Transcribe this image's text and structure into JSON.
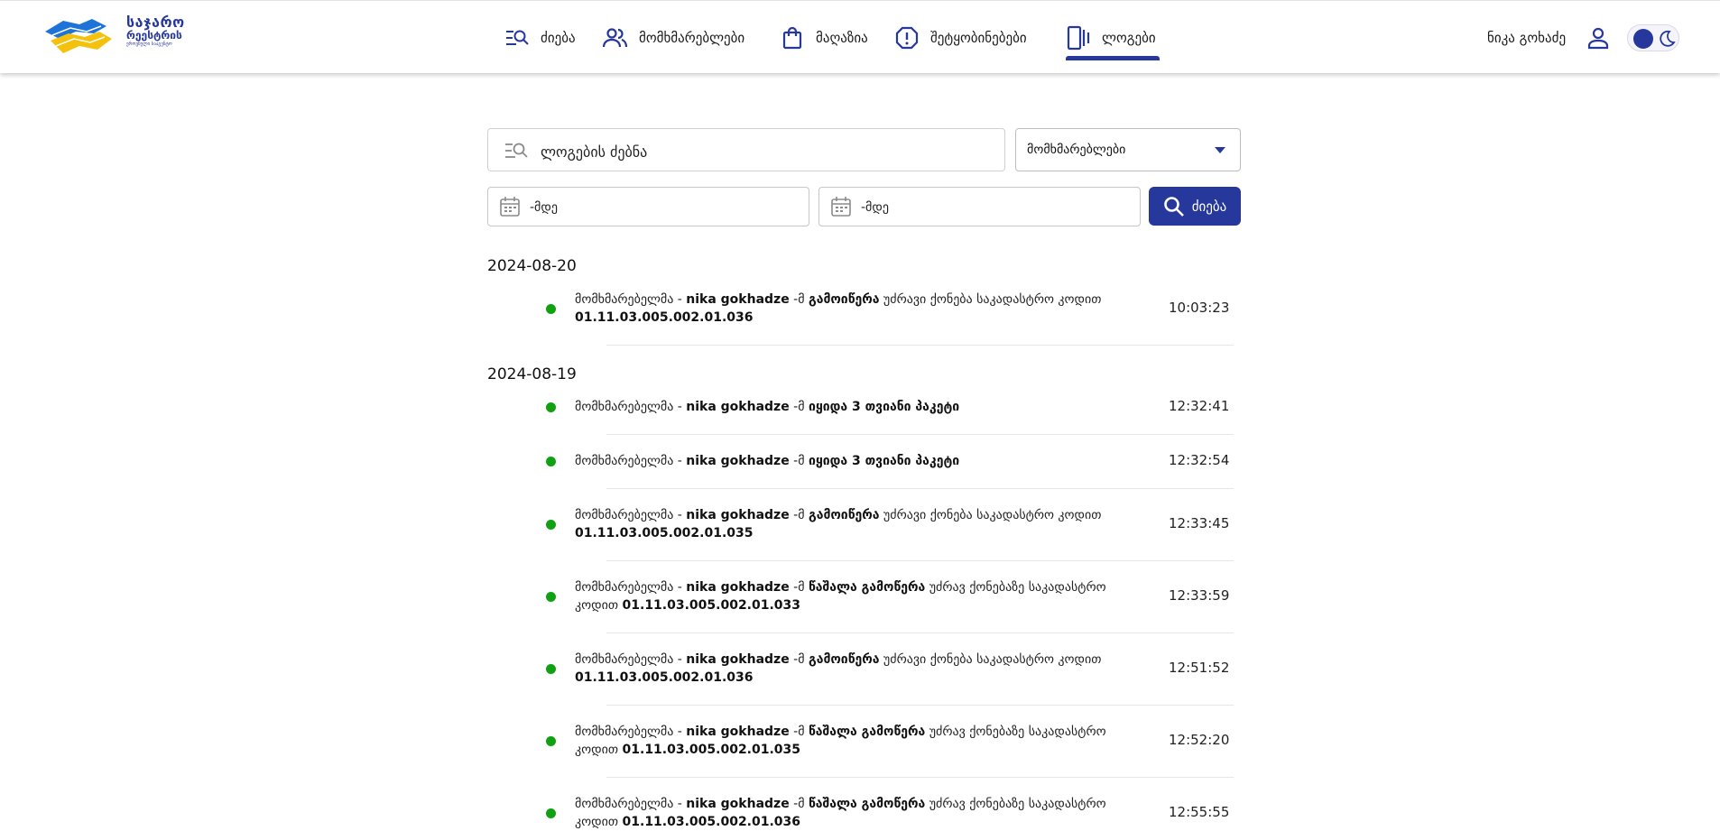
{
  "header": {
    "logo": {
      "line1": "საჯარო",
      "line2": "რეესტრის",
      "line3": "ეროვნული სააგენტო"
    },
    "nav": [
      {
        "label": "ძიება",
        "icon": "search-list-icon"
      },
      {
        "label": "მომხმარებლები",
        "icon": "users-icon"
      },
      {
        "label": "მაღაზია",
        "icon": "shopping-bag-icon"
      },
      {
        "label": "შეტყობინებები",
        "icon": "alert-icon"
      },
      {
        "label": "ლოგები",
        "icon": "logs-icon",
        "active": true
      }
    ],
    "user_name": "ნიკა გოხაძე",
    "accent_color": "#26389c"
  },
  "filters": {
    "search_placeholder": "ლოგების ძებნა",
    "search_value": "",
    "select_value": "მომხმარებლები",
    "date_from_placeholder": "-მდე",
    "date_to_placeholder": "-მდე",
    "search_button": "ძიება"
  },
  "logs": [
    {
      "date": "2024-08-20",
      "entries": [
        {
          "parts": [
            {
              "t": "მომხმარებელმა - "
            },
            {
              "t": "nika gokhadze",
              "b": true
            },
            {
              "t": " -მ "
            },
            {
              "t": "გამოიწერა",
              "b": true
            },
            {
              "t": " უძრავი ქონება საკადასტრო კოდით "
            },
            {
              "t": "01.11.03.005.002.01.036",
              "b": true
            }
          ],
          "time": "10:03:23"
        }
      ]
    },
    {
      "date": "2024-08-19",
      "entries": [
        {
          "parts": [
            {
              "t": "მომხმარებელმა - "
            },
            {
              "t": "nika gokhadze",
              "b": true
            },
            {
              "t": " -მ "
            },
            {
              "t": "იყიდა 3 თვიანი პაკეტი",
              "b": true
            }
          ],
          "time": "12:32:41"
        },
        {
          "parts": [
            {
              "t": "მომხმარებელმა - "
            },
            {
              "t": "nika gokhadze",
              "b": true
            },
            {
              "t": " -მ "
            },
            {
              "t": "იყიდა 3 თვიანი პაკეტი",
              "b": true
            }
          ],
          "time": "12:32:54"
        },
        {
          "parts": [
            {
              "t": "მომხმარებელმა - "
            },
            {
              "t": "nika gokhadze",
              "b": true
            },
            {
              "t": " -მ "
            },
            {
              "t": "გამოიწერა",
              "b": true
            },
            {
              "t": " უძრავი ქონება საკადასტრო კოდით "
            },
            {
              "t": "01.11.03.005.002.01.035",
              "b": true
            }
          ],
          "time": "12:33:45"
        },
        {
          "parts": [
            {
              "t": "მომხმარებელმა - "
            },
            {
              "t": "nika gokhadze",
              "b": true
            },
            {
              "t": " -მ "
            },
            {
              "t": "წაშალა გამოწერა",
              "b": true
            },
            {
              "t": " უძრავ ქონებაზე საკადასტრო კოდით "
            },
            {
              "t": "01.11.03.005.002.01.033",
              "b": true
            }
          ],
          "time": "12:33:59"
        },
        {
          "parts": [
            {
              "t": "მომხმარებელმა - "
            },
            {
              "t": "nika gokhadze",
              "b": true
            },
            {
              "t": " -მ "
            },
            {
              "t": "გამოიწერა",
              "b": true
            },
            {
              "t": " უძრავი ქონება საკადასტრო კოდით "
            },
            {
              "t": "01.11.03.005.002.01.036",
              "b": true
            }
          ],
          "time": "12:51:52"
        },
        {
          "parts": [
            {
              "t": "მომხმარებელმა - "
            },
            {
              "t": "nika gokhadze",
              "b": true
            },
            {
              "t": " -მ "
            },
            {
              "t": "წაშალა გამოწერა",
              "b": true
            },
            {
              "t": " უძრავ ქონებაზე საკადასტრო კოდით "
            },
            {
              "t": "01.11.03.005.002.01.035",
              "b": true
            }
          ],
          "time": "12:52:20"
        },
        {
          "parts": [
            {
              "t": "მომხმარებელმა - "
            },
            {
              "t": "nika gokhadze",
              "b": true
            },
            {
              "t": " -მ "
            },
            {
              "t": "წაშალა გამოწერა",
              "b": true
            },
            {
              "t": " უძრავ ქონებაზე საკადასტრო კოდით "
            },
            {
              "t": "01.11.03.005.002.01.036",
              "b": true
            }
          ],
          "time": "12:55:55"
        }
      ]
    }
  ],
  "status_dot_color": "#0fa10f"
}
